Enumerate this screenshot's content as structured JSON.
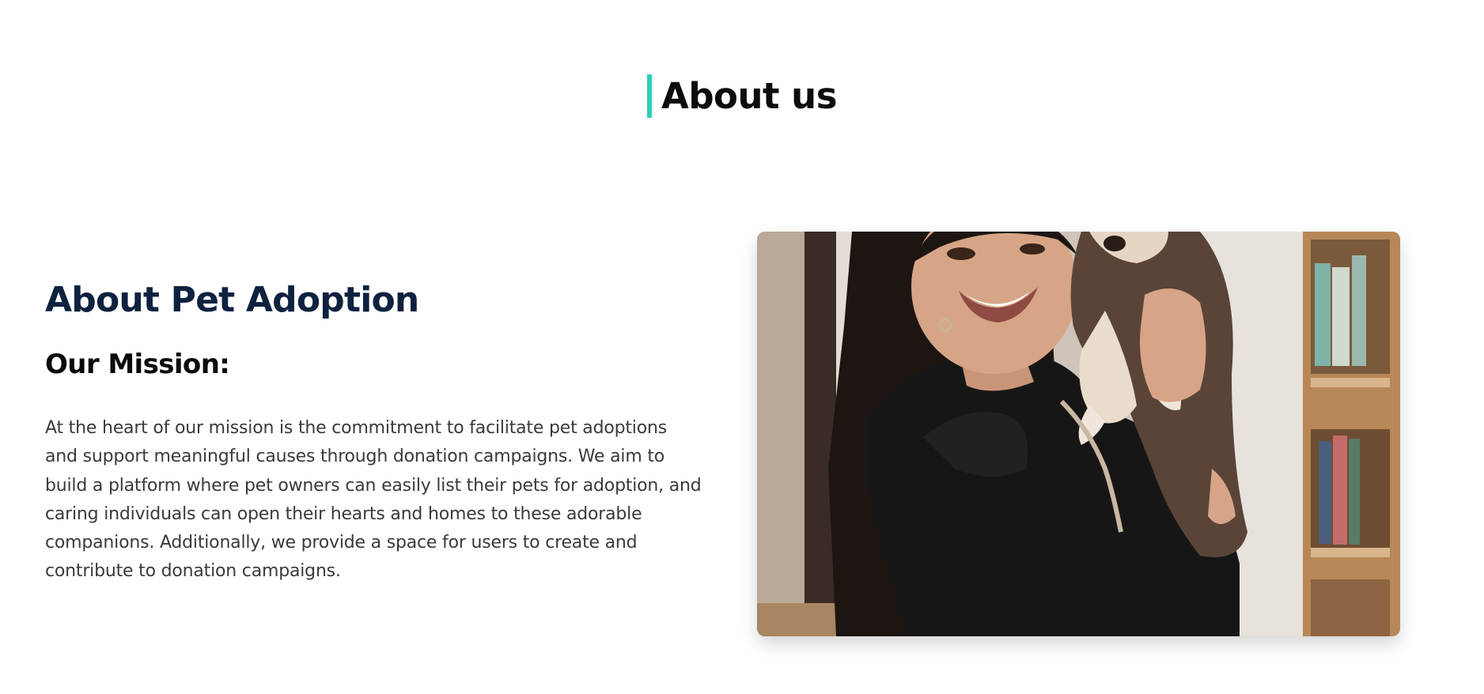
{
  "section": {
    "heading": "About us",
    "accent_color": "#2ccfb9"
  },
  "about": {
    "title": "About Pet Adoption",
    "mission_heading": "Our Mission:",
    "mission_text": "At the heart of our mission is the commitment to facilitate pet adoptions and support meaningful causes through donation campaigns. We aim to build a platform where pet owners can easily list their pets for adoption, and caring individuals can open their hearts and homes to these adorable companions. Additionally, we provide a space for users to create and contribute to donation campaigns."
  },
  "colors": {
    "title": "#0e2240",
    "body_text": "#3a3a3a"
  }
}
